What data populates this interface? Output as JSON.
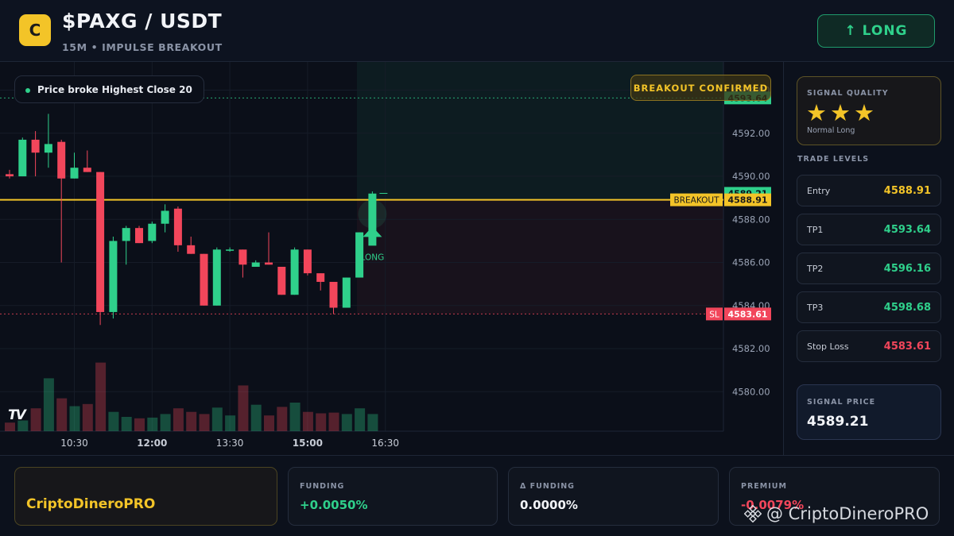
{
  "header": {
    "logo_letter": "C",
    "title": "$PAXG / USDT",
    "subtitle": "15M • IMPULSE BREAKOUT",
    "direction_button": "↑ LONG"
  },
  "chart": {
    "info_pill": "Price broke Highest Close 20",
    "breakout_badge": "BREAKOUT CONFIRMED",
    "breakout_line_label": "BREAKOUT",
    "sl_line_label": "SL",
    "long_marker_label": "LONG",
    "tv_logo": "TV",
    "colors": {
      "up": "#2fd08b",
      "down": "#f2465b",
      "breakout": "#f3c428"
    }
  },
  "chart_data": {
    "type": "candlestick",
    "y_ticks": [
      "4594.00",
      "4592.00",
      "4590.00",
      "4588.00",
      "4586.00",
      "4584.00",
      "4582.00",
      "4580.00"
    ],
    "ylim": [
      4579.2,
      4594.5
    ],
    "x_ticks": [
      "10:30",
      "12:00",
      "13:30",
      "15:00",
      "16:30"
    ],
    "price_labels": {
      "tp1": "4593.64",
      "last": "4589.21",
      "breakout": "4588.91",
      "sl": "4583.61"
    },
    "levels": {
      "tp1": 4593.64,
      "last": 4589.21,
      "breakout": 4588.91,
      "sl": 4583.61
    },
    "candles": [
      [
        4590.1,
        4590.3,
        4589.9,
        4590.0
      ],
      [
        4590.0,
        4591.8,
        4590.0,
        4591.7
      ],
      [
        4591.7,
        4592.1,
        4590.0,
        4591.1
      ],
      [
        4591.1,
        4592.9,
        4590.4,
        4591.5
      ],
      [
        4591.6,
        4591.7,
        4586.0,
        4589.9
      ],
      [
        4589.9,
        4591.1,
        4589.9,
        4590.4
      ],
      [
        4590.4,
        4591.2,
        4590.2,
        4590.2
      ],
      [
        4590.2,
        4590.2,
        4583.1,
        4583.7
      ],
      [
        4583.7,
        4587.2,
        4583.4,
        4587.0
      ],
      [
        4587.0,
        4587.7,
        4585.9,
        4587.6
      ],
      [
        4587.6,
        4587.7,
        4586.9,
        4586.9
      ],
      [
        4587.0,
        4587.9,
        4586.9,
        4587.8
      ],
      [
        4587.8,
        4588.7,
        4587.4,
        4588.4
      ],
      [
        4588.5,
        4588.6,
        4586.5,
        4586.8
      ],
      [
        4586.8,
        4587.2,
        4586.4,
        4586.4
      ],
      [
        4586.4,
        4586.4,
        4584.0,
        4584.0
      ],
      [
        4584.0,
        4586.7,
        4584.0,
        4586.6
      ],
      [
        4586.6,
        4586.7,
        4586.5,
        4586.6
      ],
      [
        4586.6,
        4586.6,
        4585.3,
        4585.9
      ],
      [
        4585.8,
        4586.1,
        4585.8,
        4586.0
      ],
      [
        4586.0,
        4587.4,
        4585.9,
        4585.9
      ],
      [
        4585.8,
        4585.8,
        4584.5,
        4584.5
      ],
      [
        4584.5,
        4586.7,
        4584.5,
        4586.6
      ],
      [
        4586.6,
        4586.6,
        4585.4,
        4585.5
      ],
      [
        4585.5,
        4585.5,
        4584.7,
        4585.1
      ],
      [
        4585.1,
        4585.1,
        4583.6,
        4583.9
      ],
      [
        4583.9,
        4585.3,
        4583.9,
        4585.3
      ],
      [
        4585.3,
        4587.4,
        4585.3,
        4587.4
      ],
      [
        4587.4,
        4589.3,
        4587.3,
        4589.2
      ]
    ],
    "volumes": [
      0.12,
      0.15,
      0.32,
      0.74,
      0.46,
      0.35,
      0.38,
      0.96,
      0.27,
      0.2,
      0.18,
      0.19,
      0.24,
      0.32,
      0.27,
      0.24,
      0.33,
      0.22,
      0.64,
      0.37,
      0.22,
      0.34,
      0.4,
      0.27,
      0.25,
      0.26,
      0.24,
      0.32,
      0.24
    ]
  },
  "panel": {
    "quality_label": "SIGNAL QUALITY",
    "stars": "★★★",
    "quality_note": "Normal Long",
    "trade_levels_label": "TRADE LEVELS",
    "levels": [
      {
        "name": "Entry",
        "value": "4588.91",
        "color": "#f3c428"
      },
      {
        "name": "TP1",
        "value": "4593.64",
        "color": "#2fd08b"
      },
      {
        "name": "TP2",
        "value": "4596.16",
        "color": "#2fd08b"
      },
      {
        "name": "TP3",
        "value": "4598.68",
        "color": "#2fd08b"
      },
      {
        "name": "Stop Loss",
        "value": "4583.61",
        "color": "#f2465b"
      }
    ],
    "signal_price_label": "SIGNAL PRICE",
    "signal_price": "4589.21"
  },
  "footer": {
    "brand": "CriptoDineroPRO",
    "funding_label": "FUNDING",
    "funding_value": "+0.0050%",
    "delta_funding_label": "Δ FUNDING",
    "delta_funding_value": "0.0000%",
    "premium_label": "PREMIUM",
    "premium_value": "-0.0079%",
    "watermark": "@ CriptoDineroPRO"
  }
}
